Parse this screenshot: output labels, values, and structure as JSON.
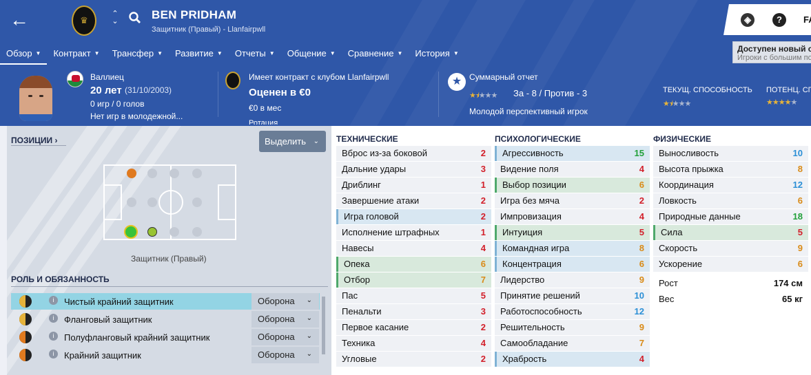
{
  "colors": {
    "header_bg": "#2f57a8",
    "accent_white": "#ffffff",
    "attr_red": "#d21f2a",
    "attr_orange": "#d98b18",
    "attr_green": "#22a03a",
    "attr_blue": "#2b8fd6",
    "selected_role": "#93d4e4"
  },
  "header": {
    "player_name": "BEN PRIDHAM",
    "player_sub": "Защитник (Правый) - Llanfairpwll",
    "notice_title": "Доступен новый со",
    "notice_sub": "Игроки с большим по",
    "fm_text": "FA"
  },
  "nav": [
    {
      "label": "Обзор",
      "active": true
    },
    {
      "label": "Контракт"
    },
    {
      "label": "Трансфер"
    },
    {
      "label": "Развитие"
    },
    {
      "label": "Отчеты"
    },
    {
      "label": "Общение"
    },
    {
      "label": "Сравнение"
    },
    {
      "label": "История"
    }
  ],
  "summary": {
    "nationality": "Валлиец",
    "age": "20 лет",
    "dob": "(31/10/2003)",
    "games": "0 игр / 0 голов",
    "youth": "Нет игр в молодежной...",
    "contract": "Имеет контракт с клубом Llanfairpwll",
    "value": "Оценен в €0",
    "wage": "€0 в мес",
    "wage_cut": "Ротация",
    "report_title": "Суммарный отчет",
    "report_stats": "За - 8 / Против - 3",
    "report_desc": "Молодой перспективный игрок",
    "report_stars": 1.5,
    "ca_label": "ТЕКУЩ. СПОСОБНОСТЬ",
    "ca_stars": 1.5,
    "pa_label": "ПОТЕНЦ. СПОСОБ",
    "pa_stars": 4.0
  },
  "left": {
    "positions_label": "ПОЗИЦИИ",
    "select_btn": "Выделить",
    "position_name": "Защитник (Правый)",
    "role_header": "РОЛЬ И ОБЯЗАННОСТЬ",
    "roles": [
      {
        "name": "Чистый крайний защитник",
        "duty": "Оборона",
        "selected": true
      },
      {
        "name": "Фланговый защитник",
        "duty": "Оборона"
      },
      {
        "name": "Полуфланговый крайний защитник",
        "duty": "Оборона"
      },
      {
        "name": "Крайний защитник",
        "duty": "Оборона"
      }
    ]
  },
  "attributes": {
    "technical_label": "ТЕХНИЧЕСКИЕ",
    "mental_label": "ПСИХОЛОГИЧЕСКИЕ",
    "physical_label": "ФИЗИЧЕСКИЕ",
    "technical": [
      {
        "name": "Вброс из-за боковой",
        "value": "2"
      },
      {
        "name": "Дальние удары",
        "value": "3"
      },
      {
        "name": "Дриблинг",
        "value": "1"
      },
      {
        "name": "Завершение атаки",
        "value": "2"
      },
      {
        "name": "Игра головой",
        "value": "2",
        "hl": "hb"
      },
      {
        "name": "Исполнение штрафных",
        "value": "1"
      },
      {
        "name": "Навесы",
        "value": "4"
      },
      {
        "name": "Опека",
        "value": "6",
        "hl": "hg"
      },
      {
        "name": "Отбор",
        "value": "7",
        "hl": "hg"
      },
      {
        "name": "Пас",
        "value": "5"
      },
      {
        "name": "Пенальти",
        "value": "3"
      },
      {
        "name": "Первое касание",
        "value": "2"
      },
      {
        "name": "Техника",
        "value": "4"
      },
      {
        "name": "Угловые",
        "value": "2"
      }
    ],
    "mental": [
      {
        "name": "Агрессивность",
        "value": "15",
        "hl": "hb"
      },
      {
        "name": "Видение поля",
        "value": "4"
      },
      {
        "name": "Выбор позиции",
        "value": "6",
        "hl": "hg"
      },
      {
        "name": "Игра без мяча",
        "value": "2"
      },
      {
        "name": "Импровизация",
        "value": "4"
      },
      {
        "name": "Интуиция",
        "value": "5",
        "hl": "hg"
      },
      {
        "name": "Командная игра",
        "value": "8",
        "hl": "hb"
      },
      {
        "name": "Концентрация",
        "value": "6",
        "hl": "hb"
      },
      {
        "name": "Лидерство",
        "value": "9"
      },
      {
        "name": "Принятие решений",
        "value": "10"
      },
      {
        "name": "Работоспособность",
        "value": "12"
      },
      {
        "name": "Решительность",
        "value": "9"
      },
      {
        "name": "Самообладание",
        "value": "7"
      },
      {
        "name": "Храбрость",
        "value": "4",
        "hl": "hb"
      }
    ],
    "physical": [
      {
        "name": "Выносливость",
        "value": "10"
      },
      {
        "name": "Высота прыжка",
        "value": "8"
      },
      {
        "name": "Координация",
        "value": "12"
      },
      {
        "name": "Ловкость",
        "value": "6"
      },
      {
        "name": "Природные данные",
        "value": "18"
      },
      {
        "name": "Сила",
        "value": "5",
        "hl": "hg"
      },
      {
        "name": "Скорость",
        "value": "9"
      },
      {
        "name": "Ускорение",
        "value": "6"
      }
    ],
    "height_label": "Рост",
    "height": "174 см",
    "weight_label": "Вес",
    "weight": "65 кг"
  }
}
